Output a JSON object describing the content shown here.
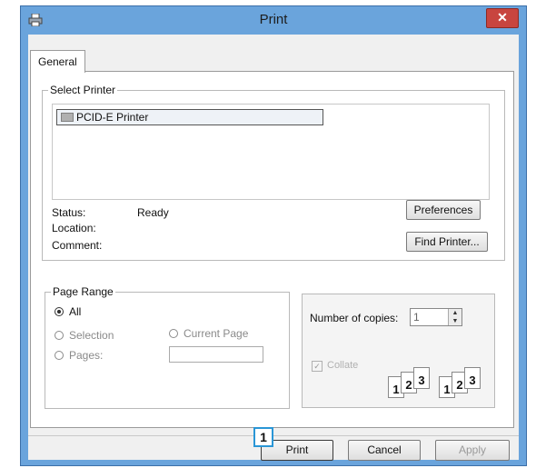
{
  "window": {
    "title": "Print",
    "close_glyph": "✕",
    "title_icon": "printer-icon"
  },
  "tabs": [
    {
      "label": "General"
    }
  ],
  "select_printer": {
    "legend": "Select Printer",
    "printers": [
      {
        "name": "PCID-E Printer",
        "icon": "printer-icon",
        "selected": true
      }
    ],
    "status_label": "Status:",
    "status_value": "Ready",
    "location_label": "Location:",
    "comment_label": "Comment:",
    "preferences_button": "Preferences",
    "find_printer_button": "Find Printer..."
  },
  "page_range": {
    "legend": "Page Range",
    "options": [
      {
        "label": "All",
        "selected": true,
        "enabled": true
      },
      {
        "label": "Selection",
        "selected": false,
        "enabled": false
      },
      {
        "label": "Current Page",
        "selected": false,
        "enabled": false
      },
      {
        "label": "Pages:",
        "selected": false,
        "enabled": false
      }
    ],
    "pages_value": ""
  },
  "copies": {
    "label": "Number of copies:",
    "value": "1",
    "collate_label": "Collate",
    "collate_checked": true,
    "collate_enabled": false,
    "stack_pages": [
      "1",
      "2",
      "3"
    ]
  },
  "footer": {
    "print_button": "Print",
    "cancel_button": "Cancel",
    "apply_button": "Apply",
    "callout_number": "1"
  },
  "colors": {
    "titlebar": "#6aa4dc",
    "close_button": "#c8453f",
    "callout_border": "#2a96d6"
  }
}
